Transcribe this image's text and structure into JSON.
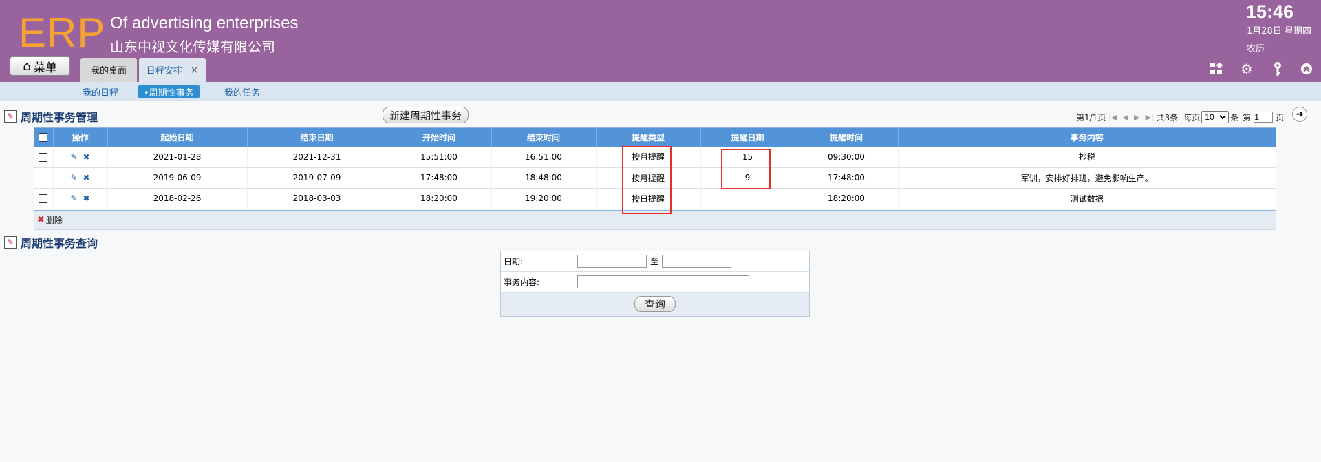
{
  "header": {
    "logo": "ERP",
    "en_title": "Of advertising enterprises",
    "cn_title": "山东中视文化传媒有限公司",
    "menu_label": "菜单",
    "time": "15:46",
    "date": "1月28日 星期四",
    "lunar": "农历",
    "tabs": [
      {
        "label": "我的桌面"
      },
      {
        "label": "日程安排",
        "close": "×"
      }
    ],
    "icons": [
      "grid-add-icon",
      "gear-icon",
      "key-icon",
      "collapse-up-icon"
    ]
  },
  "subnav": {
    "items": [
      {
        "label": "我的日程"
      },
      {
        "label": "•周期性事务"
      },
      {
        "label": "我的任务"
      }
    ]
  },
  "manage": {
    "title": "周期性事务管理",
    "new_button": "新建周期性事务",
    "pager": {
      "page_info": "第1/1页",
      "total": "共3条",
      "per_page_label": "每页",
      "per_page_value": "10",
      "per_page_unit": "条",
      "goto_label": "第",
      "goto_value": "1",
      "goto_unit": "页"
    },
    "columns": [
      "操作",
      "起始日期",
      "结束日期",
      "开始时间",
      "结束时间",
      "提醒类型",
      "提醒日期",
      "提醒时间",
      "事务内容"
    ],
    "rows": [
      {
        "start_date": "2021-01-28",
        "end_date": "2021-12-31",
        "start_time": "15:51:00",
        "end_time": "16:51:00",
        "remind_type": "按月提醒",
        "remind_date": "15",
        "remind_time": "09:30:00",
        "content": "抄税"
      },
      {
        "start_date": "2019-06-09",
        "end_date": "2019-07-09",
        "start_time": "17:48:00",
        "end_time": "18:48:00",
        "remind_type": "按月提醒",
        "remind_date": "9",
        "remind_time": "17:48:00",
        "content": "军训，安排好排班，避免影响生产。"
      },
      {
        "start_date": "2018-02-26",
        "end_date": "2018-03-03",
        "start_time": "18:20:00",
        "end_time": "19:20:00",
        "remind_type": "按日提醒",
        "remind_date": "",
        "remind_time": "18:20:00",
        "content": "测试数据"
      }
    ],
    "delete_label": "删除"
  },
  "query": {
    "title": "周期性事务查询",
    "date_label": "日期:",
    "to_label": "至",
    "content_label": "事务内容:",
    "button": "查询"
  },
  "colors": {
    "header_bg": "#99639d",
    "logo": "#f7a333",
    "table_header": "#5394d8",
    "highlight_box": "#e0312b"
  }
}
